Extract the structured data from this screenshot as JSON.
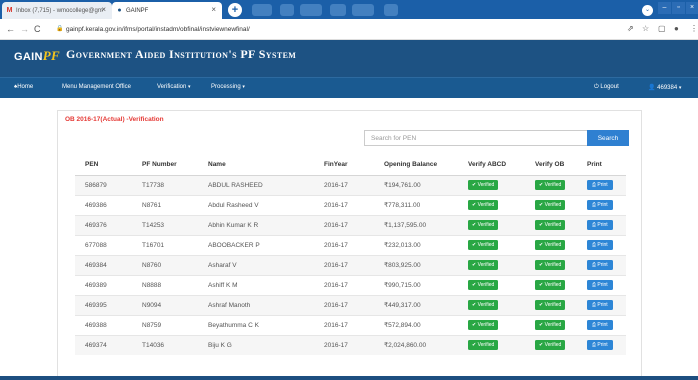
{
  "browser": {
    "tabs": [
      {
        "label": "Inbox (7,715) - wmocollege@gm",
        "icon": "gmail-icon"
      },
      {
        "label": "GAINPF",
        "icon": "gainpf-favicon"
      }
    ],
    "url": "gainpf.kerala.gov.in/ifms/portal/instadm/obfinal/instviewnewfinal/"
  },
  "app": {
    "logo_prefix": "GAIN",
    "logo_suffix": "PF",
    "title": "Government Aided Institution's PF System"
  },
  "nav": {
    "home": "Home",
    "management": "Menu Management Office",
    "verification": "Verification",
    "processing": "Processing",
    "logout": "Logout",
    "user": "469384"
  },
  "card": {
    "title": "OB 2016-17(Actual) -Verification",
    "search_placeholder": "Search for PEN",
    "search_button": "Search"
  },
  "table": {
    "headers": [
      "PEN",
      "PF Number",
      "Name",
      "FinYear",
      "Opening Balance",
      "Verify ABCD",
      "Verify OB",
      "Print"
    ],
    "rows": [
      {
        "pen": "586879",
        "pf": "T17738",
        "name": "ABDUL RASHEED",
        "fy": "2016-17",
        "ob": "₹194,761.00",
        "abcd": "Verified",
        "vob": "Verified",
        "print": "Print"
      },
      {
        "pen": "469386",
        "pf": "N8761",
        "name": "Abdul Rasheed V",
        "fy": "2016-17",
        "ob": "₹778,311.00",
        "abcd": "Verified",
        "vob": "Verified",
        "print": "Print"
      },
      {
        "pen": "469376",
        "pf": "T14253",
        "name": "Abhin Kumar K R",
        "fy": "2016-17",
        "ob": "₹1,137,595.00",
        "abcd": "Verified",
        "vob": "Verified",
        "print": "Print"
      },
      {
        "pen": "677088",
        "pf": "T16701",
        "name": "ABOOBACKER P",
        "fy": "2016-17",
        "ob": "₹232,013.00",
        "abcd": "Verified",
        "vob": "Verified",
        "print": "Print"
      },
      {
        "pen": "469384",
        "pf": "N8760",
        "name": "Asharaf V",
        "fy": "2016-17",
        "ob": "₹803,925.00",
        "abcd": "Verified",
        "vob": "Verified",
        "print": "Print"
      },
      {
        "pen": "469389",
        "pf": "N8888",
        "name": "Ashiff K M",
        "fy": "2016-17",
        "ob": "₹990,715.00",
        "abcd": "Verified",
        "vob": "Verified",
        "print": "Print"
      },
      {
        "pen": "469395",
        "pf": "N9094",
        "name": "Ashraf Manoth",
        "fy": "2016-17",
        "ob": "₹449,317.00",
        "abcd": "Verified",
        "vob": "Verified",
        "print": "Print"
      },
      {
        "pen": "469388",
        "pf": "N8759",
        "name": "Beyathumma C K",
        "fy": "2016-17",
        "ob": "₹572,894.00",
        "abcd": "Verified",
        "vob": "Verified",
        "print": "Print"
      },
      {
        "pen": "469374",
        "pf": "T14036",
        "name": "Biju K G",
        "fy": "2016-17",
        "ob": "₹2,024,860.00",
        "abcd": "Verified",
        "vob": "Verified",
        "print": "Print"
      }
    ]
  },
  "colors": {
    "header_bg": "#1d5283",
    "nav_bg": "#1a5a91",
    "title_red": "#e53935",
    "verified_green": "#29a744",
    "print_blue": "#2d86d6",
    "search_blue": "#2f80d1"
  }
}
